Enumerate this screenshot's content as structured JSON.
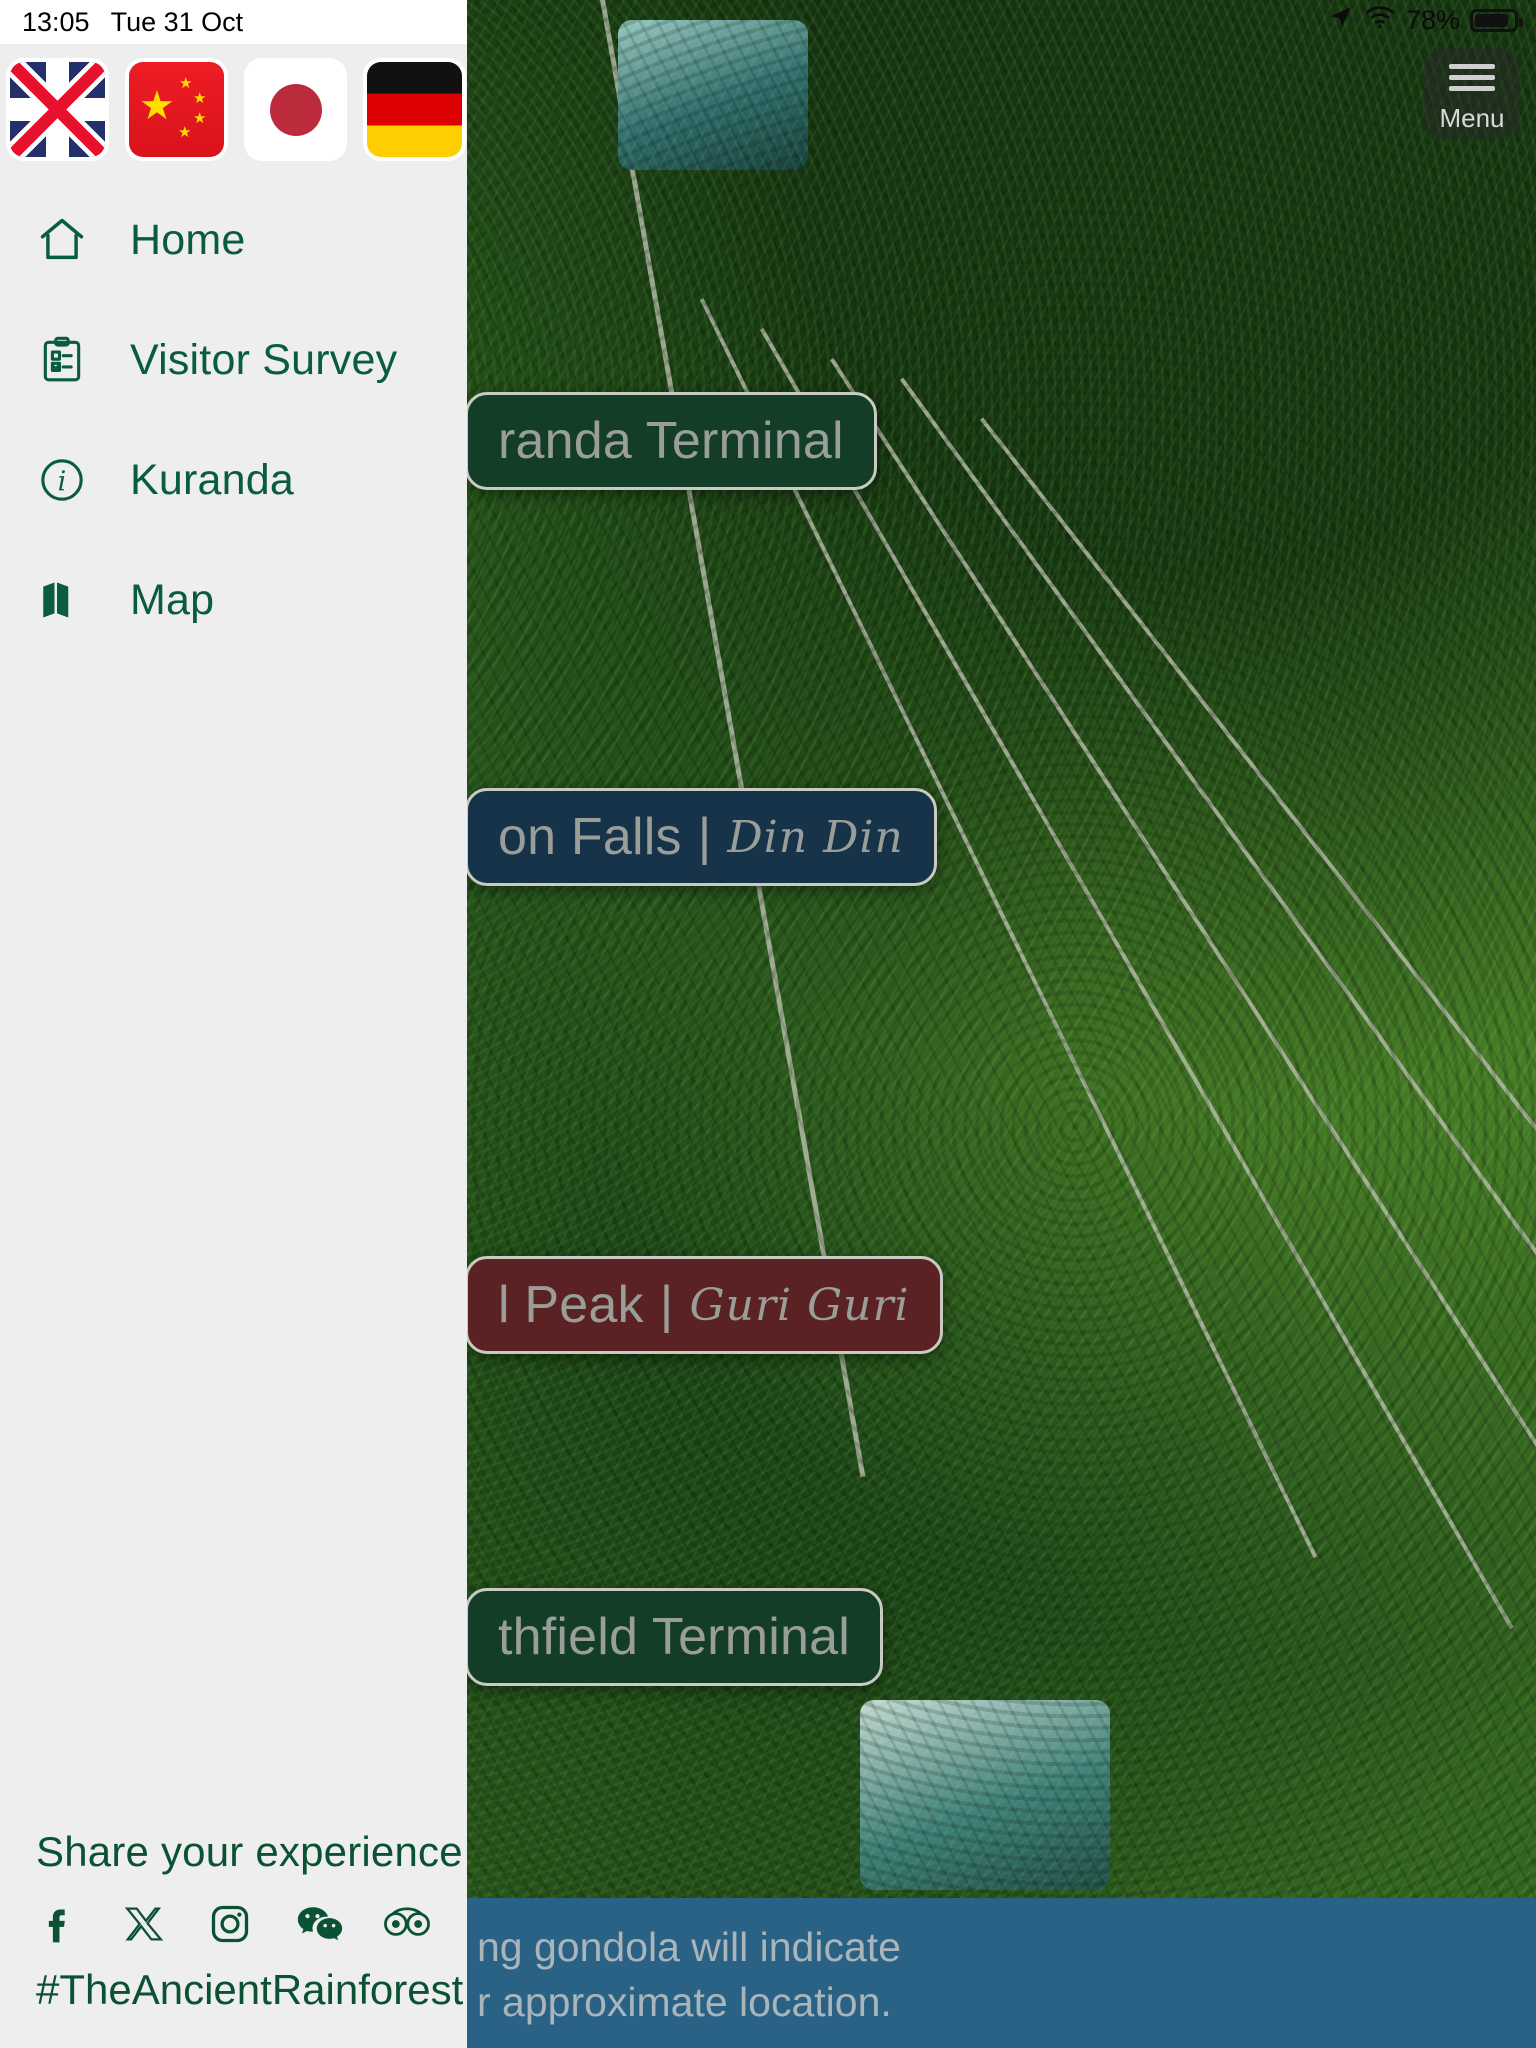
{
  "status_bar": {
    "time": "13:05",
    "date": "Tue 31 Oct",
    "battery_percent": "78%",
    "icons": [
      "location-arrow-icon",
      "wifi-icon",
      "battery-icon"
    ]
  },
  "menu_button": {
    "label": "Menu",
    "icon": "hamburger-icon"
  },
  "drawer": {
    "languages": [
      {
        "name": "English",
        "icon": "flag-uk-icon",
        "code": "uk"
      },
      {
        "name": "Chinese",
        "icon": "flag-china-icon",
        "code": "cn"
      },
      {
        "name": "Japanese",
        "icon": "flag-japan-icon",
        "code": "jp"
      },
      {
        "name": "German",
        "icon": "flag-germany-icon",
        "code": "de"
      }
    ],
    "nav_items": [
      {
        "label": "Home",
        "icon": "home-icon"
      },
      {
        "label": "Visitor Survey",
        "icon": "clipboard-checklist-icon"
      },
      {
        "label": "Kuranda",
        "icon": "info-circle-icon"
      },
      {
        "label": "Map",
        "icon": "map-icon"
      }
    ],
    "share": {
      "title": "Share your experience",
      "hashtag": "#TheAncientRainforest",
      "socials": [
        {
          "name": "Facebook",
          "icon": "facebook-icon"
        },
        {
          "name": "X",
          "icon": "x-twitter-icon"
        },
        {
          "name": "Instagram",
          "icon": "instagram-icon"
        },
        {
          "name": "WeChat",
          "icon": "wechat-icon"
        },
        {
          "name": "Tripadvisor",
          "icon": "tripadvisor-owl-icon"
        }
      ]
    }
  },
  "map_view": {
    "stations": [
      {
        "name": "Kuranda Terminal",
        "visible_text": "randa Terminal",
        "subtitle": "",
        "color": "#143d28"
      },
      {
        "name": "Barron Falls",
        "visible_text": "on Falls",
        "subtitle": "Din Din",
        "color": "#16334a"
      },
      {
        "name": "Red Peak",
        "visible_text": "l Peak",
        "subtitle": "Guri Guri",
        "color": "#5a2222"
      },
      {
        "name": "Smithfield Terminal",
        "visible_text": "thfield Terminal",
        "subtitle": "",
        "color": "#143d28"
      }
    ],
    "info_bar": {
      "line1": "ng gondola will indicate",
      "line2": "r approximate location.",
      "background": "#2a6286"
    }
  },
  "colors": {
    "brand_green": "#0a5c40",
    "share_green": "#0a5233",
    "drawer_bg": "#efeeee",
    "info_bar_blue": "#2a6286"
  }
}
